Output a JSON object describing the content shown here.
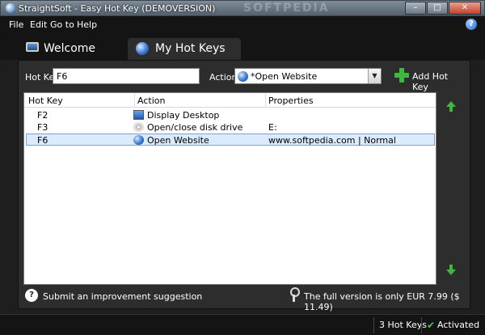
{
  "window": {
    "title": "StraightSoft - Easy Hot Key (DEMOVERSION)",
    "watermark": "SOFTPEDIA",
    "minimize": "–",
    "maximize": "□",
    "close": "✕"
  },
  "menu": {
    "items": [
      {
        "label": "File"
      },
      {
        "label": "Edit"
      },
      {
        "label": "Go to"
      },
      {
        "label": "Help"
      }
    ],
    "help_glyph": "?"
  },
  "tabs": [
    {
      "label": "Welcome",
      "icon": "monitor-icon",
      "active": false
    },
    {
      "label": "My Hot Keys",
      "icon": "globe-icon",
      "active": true
    }
  ],
  "form": {
    "hotkey_label": "Hot Key",
    "hotkey_value": "F6",
    "action_label": "Action",
    "action_value": "*Open Website",
    "add_label": "Add Hot Key"
  },
  "table": {
    "headers": [
      "Hot Key",
      "Action",
      "Properties"
    ],
    "rows": [
      {
        "key": "F2",
        "icon": "desktop-icon",
        "action": "Display Desktop",
        "properties": ""
      },
      {
        "key": "F3",
        "icon": "disk-icon",
        "action": "Open/close disk drive",
        "properties": "E:"
      },
      {
        "key": "F6",
        "icon": "globe-icon",
        "action": "Open Website",
        "properties": "www.softpedia.com | Normal",
        "selected": true
      }
    ]
  },
  "footer": {
    "suggestion": "Submit an improvement suggestion",
    "suggestion_glyph": "?",
    "promo": "The full version is only EUR 7.99 ($ 11.49)"
  },
  "status": {
    "count": "3 Hot Keys",
    "activated": "Activated",
    "check_glyph": "✔"
  },
  "colors": {
    "accent_green": "#3fb83f",
    "selection": "#dcebfc"
  }
}
